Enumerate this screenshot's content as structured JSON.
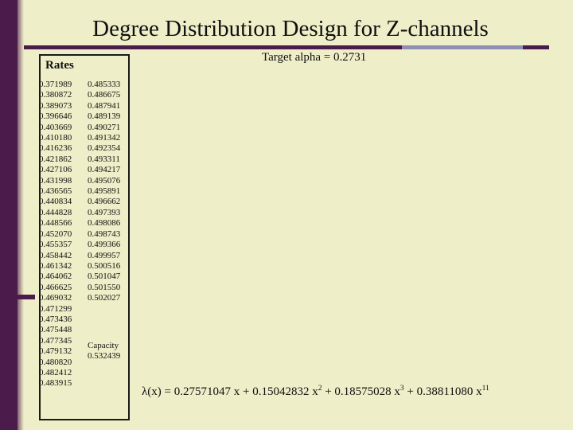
{
  "title": "Degree Distribution Design for Z-channels",
  "target_alpha": "Target alpha = 0.2731",
  "rates_box": {
    "header": "Rates",
    "column_left": [
      "0.371989",
      "0.380872",
      "0.389073",
      "0.396646",
      "0.403669",
      "0.410180",
      "0.416236",
      "0.421862",
      "0.427106",
      "0.431998",
      "0.436565",
      "0.440834",
      "0.444828",
      "0.448566",
      "0.452070",
      "0.455357",
      "0.458442",
      "0.461342",
      "0.464062",
      "0.466625",
      "0.469032",
      "0.471299",
      "0.473436",
      "0.475448",
      "0.477345",
      "0.479132",
      "0.480820",
      "0.482412",
      "0.483915"
    ],
    "column_right": [
      "0.485333",
      "0.486675",
      "0.487941",
      "0.489139",
      "0.490271",
      "0.491342",
      "0.492354",
      "0.493311",
      "0.494217",
      "0.495076",
      "0.495891",
      "0.496662",
      "0.497393",
      "0.498086",
      "0.498743",
      "0.499366",
      "0.499957",
      "0.500516",
      "0.501047",
      "0.501550",
      "0.502027"
    ],
    "capacity_label": "Capacity",
    "capacity_value": "0.532439"
  },
  "equation": {
    "lhs": "λ(x) = ",
    "term1": "0.27571047 x + ",
    "term2_coef": "0.15042832 x",
    "term2_exp": "2",
    "term2_tail": " +  ",
    "term3_coef": "0.18575028 x",
    "term3_exp": "3",
    "term3_tail": " + ",
    "term4_coef": "0.38811080 x",
    "term4_exp": "11"
  },
  "colors": {
    "background": "#eeeec8",
    "accent_dark": "#4b1b4b",
    "rule_light": "#8f8fb5",
    "text": "#101010"
  }
}
